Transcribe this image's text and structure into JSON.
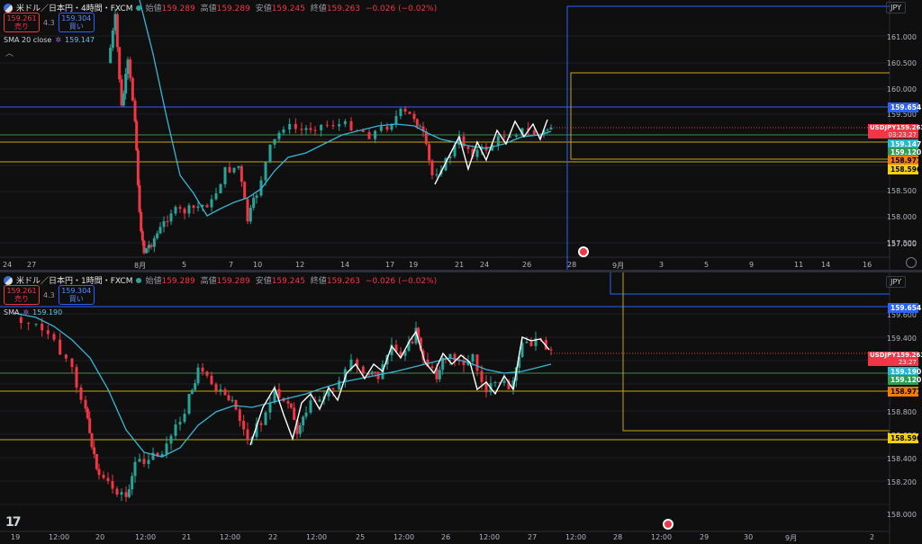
{
  "panes": [
    {
      "id": "4h",
      "title": "米ドル／日本円・4時間・FXCM",
      "ohlc": [
        {
          "label": "始値",
          "value": "159.289"
        },
        {
          "label": "高値",
          "value": "159.289"
        },
        {
          "label": "安値",
          "value": "159.245"
        },
        {
          "label": "終値",
          "value": "159.263"
        },
        {
          "label": "",
          "value": "−0.026 (−0.02%)"
        }
      ],
      "sell": {
        "price": "159.261",
        "label": "売り"
      },
      "buy": {
        "price": "159.304",
        "label": "買い"
      },
      "spread": "4.3",
      "sma_label": "SMA 20 close",
      "sma_value": "159.147",
      "currency": "JPY",
      "y_ticks": [
        "161.000",
        "160.500",
        "160.000",
        "159.500",
        "158.500",
        "158.000",
        "157.500",
        "157.000"
      ],
      "x_ticks": [
        "24",
        "27",
        "8月",
        "5",
        "7",
        "10",
        "12",
        "14",
        "17",
        "19",
        "21",
        "24",
        "26",
        "28",
        "9月",
        "3",
        "5",
        "9",
        "11",
        "14",
        "16"
      ],
      "symbol": "USDJPY",
      "current_price": "159.263",
      "countdown": "03:23:27",
      "tags": [
        "159.654",
        "159.147",
        "159.120",
        "158.977",
        "158.596"
      ]
    },
    {
      "id": "1h",
      "title": "米ドル／日本円・1時間・FXCM",
      "ohlc": [
        {
          "label": "始値",
          "value": "159.289"
        },
        {
          "label": "高値",
          "value": "159.289"
        },
        {
          "label": "安値",
          "value": "159.245"
        },
        {
          "label": "終値",
          "value": "159.263"
        },
        {
          "label": "",
          "value": "−0.026 (−0.02%)"
        }
      ],
      "sell": {
        "price": "159.261",
        "label": "売り"
      },
      "buy": {
        "price": "159.304",
        "label": "買い"
      },
      "spread": "4.3",
      "sma_label": "SMA",
      "sma_value": "159.190",
      "currency": "JPY",
      "y_ticks": [
        "159.600",
        "159.400",
        "158.800",
        "158.600",
        "158.400",
        "158.200",
        "158.000"
      ],
      "x_ticks": [
        "19",
        "12:00",
        "20",
        "12:00",
        "21",
        "12:00",
        "22",
        "12:00",
        "25",
        "12:00",
        "26",
        "12:00",
        "27",
        "12:00",
        "28",
        "12:00",
        "29",
        "30",
        "9月",
        "2"
      ],
      "symbol": "USDJPY",
      "current_price": "159.263",
      "countdown": "23:27",
      "tags": [
        "159.654",
        "159.190",
        "159.120",
        "158.977",
        "158.596"
      ]
    }
  ],
  "colors": {
    "up": "#26a69a",
    "down": "#f23645",
    "sma": "#35b6d6",
    "blue_line": "#2962ff",
    "yellow_line": "#c8a51a",
    "green_line": "#3a8f4a",
    "zigzag": "#ffffff",
    "tag_blue": "#2962ff",
    "tag_cyan": "#2bb7d4",
    "tag_green": "#2e9e56",
    "tag_orange": "#f57c00",
    "tag_yellow": "#f5d10b"
  },
  "icons": {
    "logo": "tradingview-logo-icon",
    "settings": "chart-settings-icon",
    "target": "event-marker-icon",
    "collapse": "chevron-up-icon"
  }
}
